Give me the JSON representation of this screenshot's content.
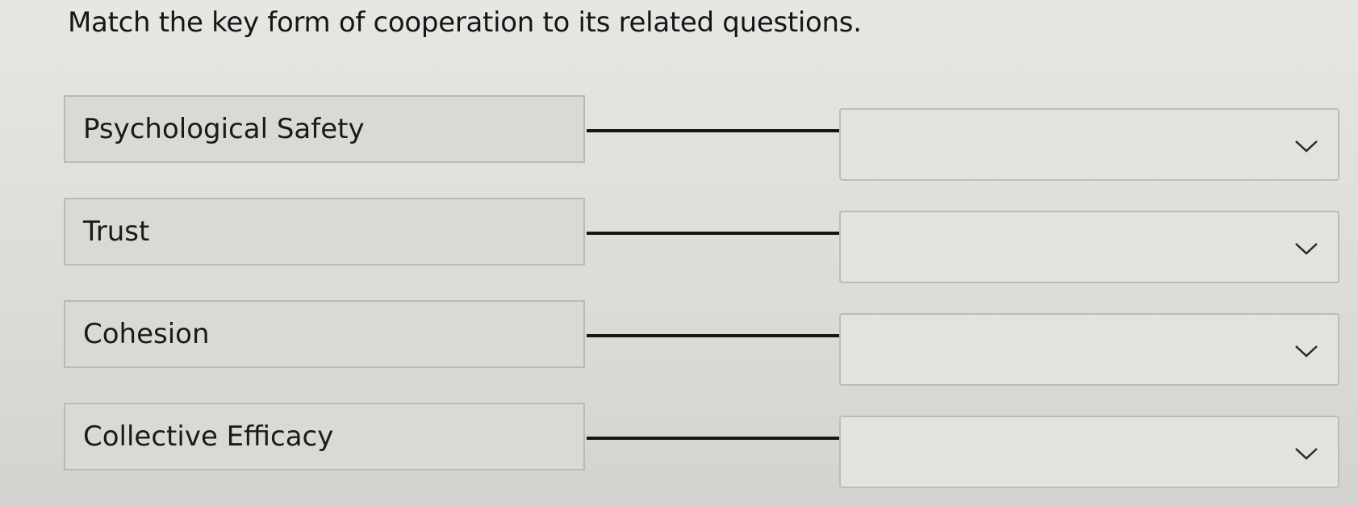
{
  "question": {
    "prompt": "Match the key form of cooperation to its related questions."
  },
  "matches": [
    {
      "term": "Psychological Safety",
      "selected": ""
    },
    {
      "term": "Trust",
      "selected": ""
    },
    {
      "term": "Cohesion",
      "selected": ""
    },
    {
      "term": "Collective Efficacy",
      "selected": ""
    }
  ],
  "icons": {
    "dropdown": "chevron-down-icon"
  },
  "colors": {
    "background": "#dcdcd9",
    "box_fill": "#d9d9d6",
    "box_border": "#b9b9b6",
    "connector": "#161616"
  }
}
